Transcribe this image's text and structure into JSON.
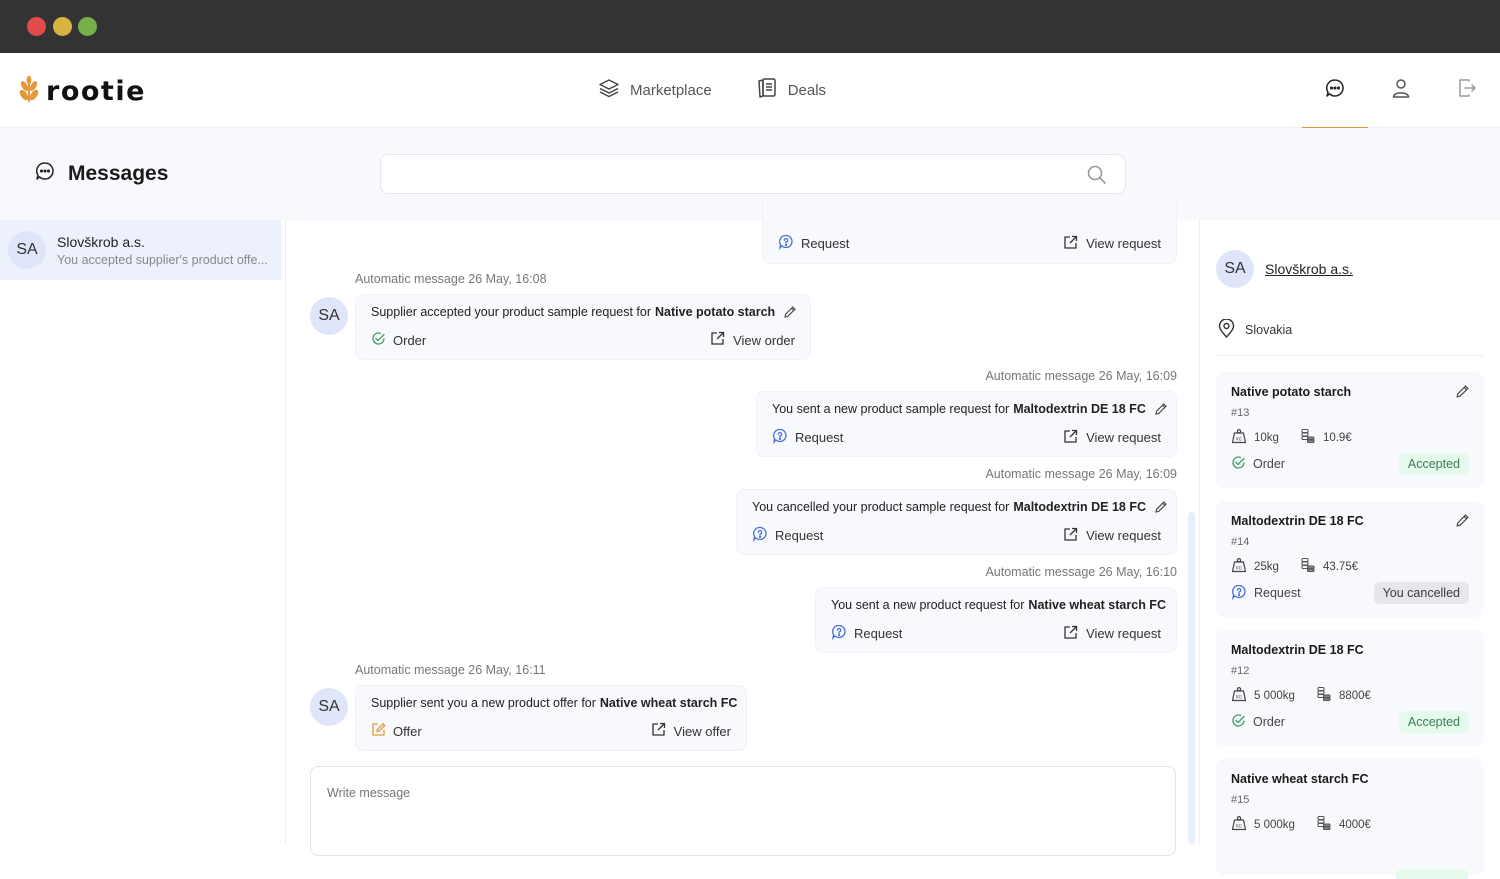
{
  "window": {
    "controls": [
      "close",
      "minimize",
      "maximize"
    ]
  },
  "brand": {
    "name": "rootie",
    "accent": "#e39a3b"
  },
  "nav": {
    "links": [
      {
        "label": "Marketplace",
        "icon": "layers-icon"
      },
      {
        "label": "Deals",
        "icon": "documents-icon"
      }
    ],
    "icons": [
      {
        "name": "messages",
        "icon": "chat-bubble-icon",
        "active": true
      },
      {
        "name": "profile",
        "icon": "user-icon",
        "active": false
      },
      {
        "name": "logout",
        "icon": "logout-icon",
        "active": false
      }
    ]
  },
  "header": {
    "title": "Messages",
    "search_placeholder": "",
    "search_value": ""
  },
  "conversations": [
    {
      "initials": "SA",
      "name": "Slovškrob a.s.",
      "preview": "You accepted supplier's product offe...",
      "selected": true
    }
  ],
  "messages": [
    {
      "side": "right",
      "partial": true,
      "tag": "Request",
      "action": "View request"
    },
    {
      "side": "left",
      "meta": "Automatic message 26 May, 16:08",
      "initials": "SA",
      "text": "Supplier accepted your product sample request for",
      "product": "Native potato starch",
      "editable": true,
      "tag": "Order",
      "action": "View order"
    },
    {
      "side": "right",
      "meta": "Automatic message 26 May, 16:09",
      "text": "You sent a new product sample request for",
      "product": "Maltodextrin DE 18 FC",
      "editable": true,
      "tag": "Request",
      "action": "View request"
    },
    {
      "side": "right",
      "meta": "Automatic message 26 May, 16:09",
      "text": "You cancelled your product sample request for",
      "product": "Maltodextrin DE 18 FC",
      "editable": true,
      "tag": "Request",
      "action": "View request"
    },
    {
      "side": "right",
      "meta": "Automatic message 26 May, 16:10",
      "text": "You sent a new product request for",
      "product": "Native wheat starch FC",
      "editable": false,
      "tag": "Request",
      "action": "View request"
    },
    {
      "side": "left",
      "meta": "Automatic message 26 May, 16:11",
      "initials": "SA",
      "text": "Supplier sent you a new product offer for",
      "product": "Native wheat starch FC",
      "editable": false,
      "tag": "Offer",
      "action": "View offer"
    }
  ],
  "composer": {
    "placeholder": "Write message"
  },
  "supplier": {
    "initials": "SA",
    "name": "Slovškrob a.s.",
    "country": "Slovakia"
  },
  "deals": [
    {
      "title": "Native potato starch",
      "id": "#13",
      "quantity": "10kg",
      "price": "10.9€",
      "type": "Order",
      "status": "Accepted",
      "editable": true
    },
    {
      "title": "Maltodextrin DE 18 FC",
      "id": "#14",
      "quantity": "25kg",
      "price": "43.75€",
      "type": "Request",
      "status": "You cancelled",
      "editable": true
    },
    {
      "title": "Maltodextrin DE 18 FC",
      "id": "#12",
      "quantity": "5 000kg",
      "price": "8800€",
      "type": "Order",
      "status": "Accepted",
      "editable": false
    },
    {
      "title": "Native wheat starch FC",
      "id": "#15",
      "quantity": "5 000kg",
      "price": "4000€",
      "type": "",
      "status": "",
      "editable": false
    }
  ],
  "colors": {
    "order": "#3f9a62",
    "request": "#4a6fd8",
    "offer": "#e39a3b",
    "accepted_bg": "#e5f9ec",
    "cancelled_bg": "#e6e7ea"
  }
}
